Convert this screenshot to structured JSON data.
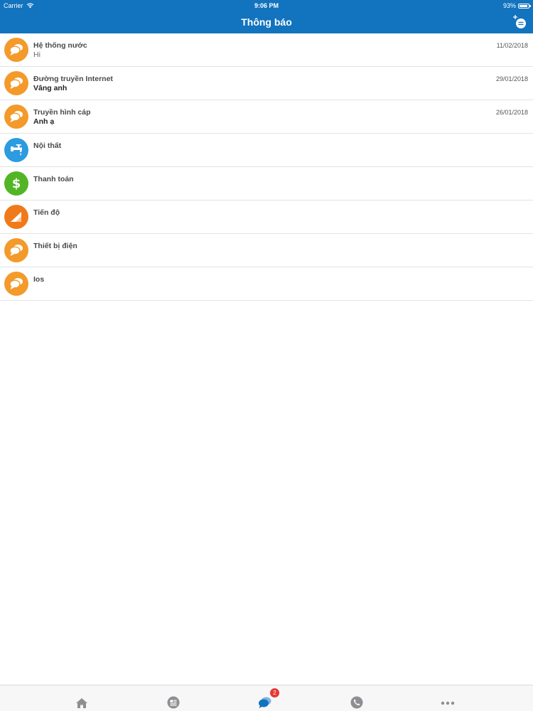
{
  "status_bar": {
    "carrier": "Carrier",
    "time": "9:06 PM",
    "battery": "93%",
    "battery_level": 0.93
  },
  "nav": {
    "title": "Thông báo",
    "compose_icon": "new-message-icon"
  },
  "notifications": [
    {
      "title": "Hệ thống nước",
      "subtitle": "Hi",
      "date": "11/02/2018",
      "icon": "chat-bubbles-icon",
      "color": "#f39a2b"
    },
    {
      "title": "Đường truyền Internet",
      "subtitle": "Vâng anh",
      "date": "29/01/2018",
      "icon": "chat-bubbles-icon",
      "color": "#f39a2b"
    },
    {
      "title": "Truyền hình cáp",
      "subtitle": "Anh ạ",
      "date": "26/01/2018",
      "icon": "chat-bubbles-icon",
      "color": "#f39a2b"
    },
    {
      "title": "Nội thất",
      "subtitle": "",
      "date": "",
      "icon": "faucet-icon",
      "color": "#2d9be0"
    },
    {
      "title": "Thanh toán",
      "subtitle": "",
      "date": "",
      "icon": "dollar-icon",
      "color": "#52b526"
    },
    {
      "title": "Tiến độ",
      "subtitle": "",
      "date": "",
      "icon": "progress-icon",
      "color": "#f07a1a"
    },
    {
      "title": "Thiết bị điện",
      "subtitle": "",
      "date": "",
      "icon": "chat-bubbles-icon",
      "color": "#f39a2b"
    },
    {
      "title": "Ios",
      "subtitle": "",
      "date": "",
      "icon": "chat-bubbles-icon",
      "color": "#f39a2b"
    }
  ],
  "tabs": [
    {
      "icon": "home-icon",
      "active": false
    },
    {
      "icon": "news-icon",
      "active": false
    },
    {
      "icon": "chat-icon",
      "active": true,
      "badge": "2"
    },
    {
      "icon": "phone-icon",
      "active": false
    },
    {
      "icon": "more-icon",
      "active": false
    }
  ],
  "colors": {
    "primary": "#1273be",
    "tab_inactive": "#8e8e93",
    "badge": "#e53935"
  }
}
